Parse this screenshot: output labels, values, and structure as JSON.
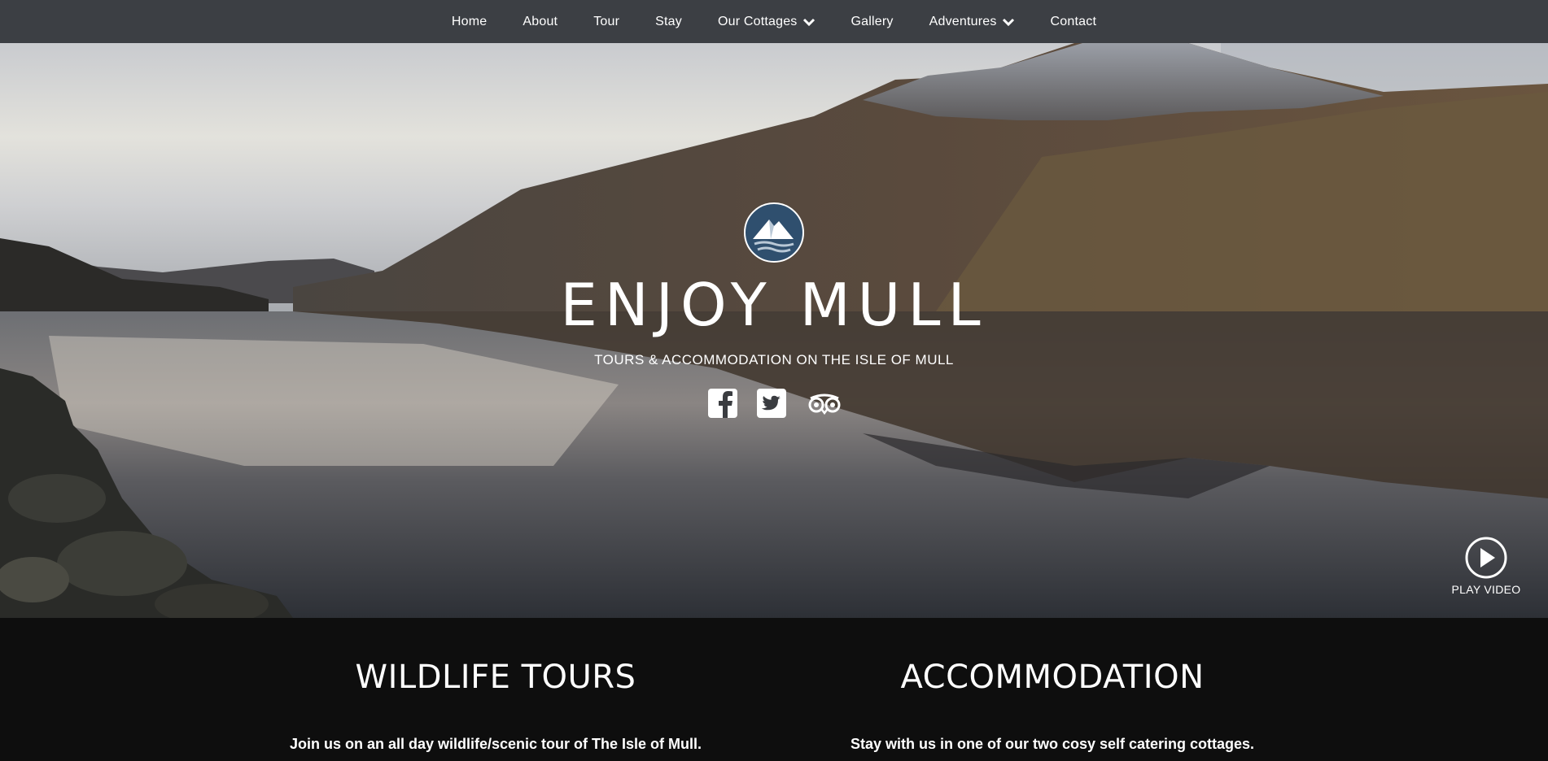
{
  "nav": {
    "items": [
      {
        "label": "Home"
      },
      {
        "label": "About"
      },
      {
        "label": "Tour"
      },
      {
        "label": "Stay"
      },
      {
        "label": "Our Cottages",
        "dropdown": true
      },
      {
        "label": "Gallery"
      },
      {
        "label": "Adventures",
        "dropdown": true
      },
      {
        "label": "Contact"
      }
    ]
  },
  "hero": {
    "title": "ENJOY MULL",
    "subtitle": "TOURS & ACCOMMODATION ON THE ISLE OF MULL",
    "social": [
      "facebook-icon",
      "twitter-icon",
      "tripadvisor-icon"
    ],
    "play_label": "PLAY VIDEO"
  },
  "sections": {
    "tours": {
      "heading": "WILDLIFE TOURS",
      "text": "Join us on an all day wildlife/scenic tour of The Isle of Mull."
    },
    "accommodation": {
      "heading": "ACCOMMODATION",
      "text": "Stay with us in one of our two cosy self catering cottages."
    }
  },
  "colors": {
    "nav_bg": "#3c3f44",
    "section_bg": "#0e0e0e",
    "logo_bg": "#2f4f6e"
  }
}
